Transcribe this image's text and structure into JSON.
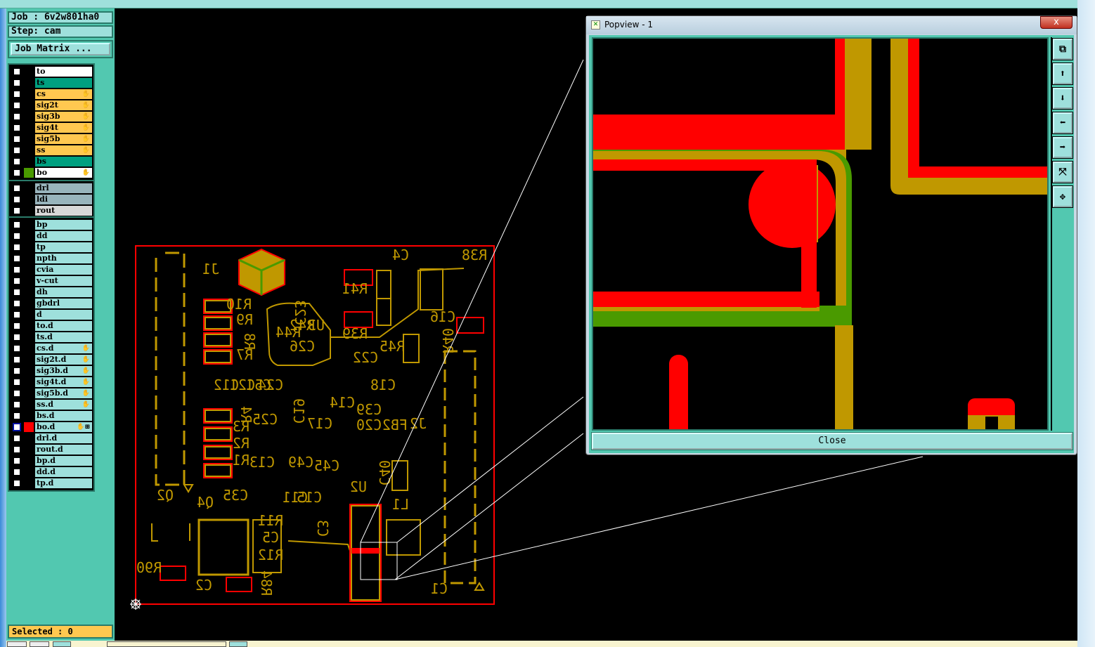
{
  "job": {
    "label": "Job : 6v2w801ha0",
    "step": "Step: cam",
    "matrix_button": "Job Matrix ..."
  },
  "colors": {
    "panel": "#52c8b0",
    "board_layer": "#ffc850",
    "mask_layer": "#00a080",
    "doc": "#9ee0dc",
    "drill": "#98b4bc",
    "red": "#ff0000",
    "gold": "#c09800",
    "green": "#4a9a00"
  },
  "layers": {
    "group1": [
      {
        "name": "to",
        "bg": "#ffffff",
        "edit": false,
        "sw": ""
      },
      {
        "name": "ts",
        "bg": "#00a080",
        "edit": false,
        "sw": ""
      },
      {
        "name": "cs",
        "bg": "#ffc850",
        "edit": true,
        "sw": ""
      },
      {
        "name": "sig2t",
        "bg": "#ffc850",
        "edit": true,
        "sw": ""
      },
      {
        "name": "sig3b",
        "bg": "#ffc850",
        "edit": true,
        "sw": ""
      },
      {
        "name": "sig4t",
        "bg": "#ffc850",
        "edit": true,
        "sw": ""
      },
      {
        "name": "sig5b",
        "bg": "#ffc850",
        "edit": true,
        "sw": ""
      },
      {
        "name": "ss",
        "bg": "#ffc850",
        "edit": true,
        "sw": ""
      },
      {
        "name": "bs",
        "bg": "#00a080",
        "edit": false,
        "sw": ""
      },
      {
        "name": "bo",
        "bg": "#ffffff",
        "edit": true,
        "sw": "#4a9a00"
      }
    ],
    "group2": [
      {
        "name": "drl",
        "bg": "#98b4bc",
        "edit": false,
        "sw": ""
      },
      {
        "name": "ldi",
        "bg": "#98b4bc",
        "edit": false,
        "sw": ""
      },
      {
        "name": "rout",
        "bg": "#d8d8d8",
        "edit": false,
        "sw": ""
      }
    ],
    "group3": [
      {
        "name": "bp",
        "edit": false
      },
      {
        "name": "dd",
        "edit": false
      },
      {
        "name": "tp",
        "edit": false
      },
      {
        "name": "npth",
        "edit": false
      },
      {
        "name": "cvia",
        "edit": false
      },
      {
        "name": "v-cut",
        "edit": false
      },
      {
        "name": "dh",
        "edit": false
      },
      {
        "name": "gbdrl",
        "edit": false
      },
      {
        "name": "d",
        "edit": false
      },
      {
        "name": "to.d",
        "edit": false
      },
      {
        "name": "ts.d",
        "edit": false
      },
      {
        "name": "cs.d",
        "edit": true
      },
      {
        "name": "sig2t.d",
        "edit": true
      },
      {
        "name": "sig3b.d",
        "edit": true
      },
      {
        "name": "sig4t.d",
        "edit": true
      },
      {
        "name": "sig5b.d",
        "edit": true
      },
      {
        "name": "ss.d",
        "edit": true
      },
      {
        "name": "bs.d",
        "edit": false
      },
      {
        "name": "bo.d",
        "edit": true,
        "sw": "#ff0000",
        "active": true
      },
      {
        "name": "drl.d",
        "edit": false
      },
      {
        "name": "rout.d",
        "edit": false
      },
      {
        "name": "bp.d",
        "edit": false
      },
      {
        "name": "dd.d",
        "edit": false
      },
      {
        "name": "tp.d",
        "edit": false
      }
    ]
  },
  "status": {
    "selected": "Selected : 0"
  },
  "popview": {
    "title": "Popview - 1",
    "close_x": "x",
    "close_button": "Close",
    "tools": [
      {
        "icon": "zoom-window-icon",
        "glyph": "⧉"
      },
      {
        "icon": "pan-up-icon",
        "glyph": "⬆"
      },
      {
        "icon": "pan-down-icon",
        "glyph": "⬇"
      },
      {
        "icon": "pan-left-icon",
        "glyph": "⬅"
      },
      {
        "icon": "pan-right-icon",
        "glyph": "➡"
      },
      {
        "icon": "zoom-in-icon",
        "glyph": "⤧"
      },
      {
        "icon": "zoom-out-icon",
        "glyph": "✥"
      }
    ]
  },
  "board": {
    "designators": [
      "J1",
      "R10",
      "R9",
      "R8",
      "R7",
      "R38",
      "C4",
      "R41",
      "R39",
      "C16",
      "R40",
      "R45",
      "C22",
      "C18",
      "U3",
      "R44",
      "R42",
      "C23",
      "C26",
      "C12",
      "C21",
      "C24",
      "C51",
      "C14",
      "C19",
      "C39",
      "C20",
      "C25",
      "C17",
      "J2",
      "FB2",
      "R4",
      "R3",
      "R2",
      "R1",
      "C13",
      "C49",
      "C45",
      "C40",
      "Q2",
      "C35",
      "Q4",
      "U2",
      "C11",
      "C15",
      "C3",
      "L1",
      "R11",
      "C5",
      "R12",
      "R90",
      "C2",
      "R84",
      "C1"
    ]
  }
}
